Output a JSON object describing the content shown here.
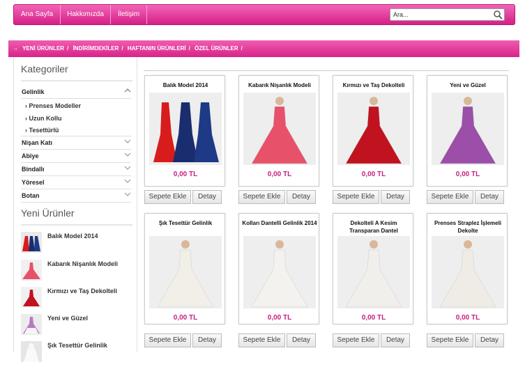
{
  "nav": {
    "home": "Ana Sayfa",
    "about": "Hakkımızda",
    "contact": "İletişim"
  },
  "search": {
    "placeholder": "Ara..."
  },
  "breadcrumb": {
    "arrow": "→",
    "items": [
      "YENİ ÜRÜNLER",
      "İNDİRİMDEKİLER",
      "HAFTANIN ÜRÜNLERİ",
      "ÖZEL ÜRÜNLER"
    ],
    "sep": "/"
  },
  "sidebar": {
    "categories_title": "Kategoriler",
    "categories": [
      {
        "label": "Gelinlik",
        "expanded": true
      },
      {
        "label": "Nişan Katı"
      },
      {
        "label": "Abiye"
      },
      {
        "label": "Bindallı"
      },
      {
        "label": "Yöresel"
      },
      {
        "label": "Botan"
      }
    ],
    "subcategories": [
      "Prenses Modeller",
      "Uzun Kollu",
      "Tesettürlü"
    ],
    "subcategory_bullet": "›",
    "new_products_title": "Yeni Ürünler",
    "new_products": [
      "Balık Model 2014",
      "Kabarık Nişanlık Modeli",
      "Kırmızı ve Taş Dekolteli",
      "Yeni ve Güzel",
      "Şık Tesettür Gelinlik"
    ]
  },
  "products": [
    {
      "title": "Balık Model 2014",
      "price": "0,00 TL",
      "colors": [
        "#d81c1c",
        "#1a2d6e",
        "#1e3a86"
      ]
    },
    {
      "title": "Kabarık Nişanlık Modeli",
      "price": "0,00 TL",
      "colors": [
        "#e8516a"
      ]
    },
    {
      "title": "Kırmızı ve Taş Dekolteli",
      "price": "0,00 TL",
      "colors": [
        "#c1121f"
      ]
    },
    {
      "title": "Yeni ve Güzel",
      "price": "0,00 TL",
      "colors": [
        "#9b4fa8"
      ]
    },
    {
      "title": "Şık Tesettür Gelinlik",
      "price": "0,00 TL",
      "colors": [
        "#f2efe9"
      ]
    },
    {
      "title": "Kolları Dantelli Gelinlik 2014",
      "price": "0,00 TL",
      "colors": [
        "#f4f2ee"
      ]
    },
    {
      "title": "Dekolteli A Kesim Transparan Dantel",
      "price": "0,00 TL",
      "colors": [
        "#f1efeb"
      ]
    },
    {
      "title": "Prenses Straplez İşlemeli Dekolte",
      "price": "0,00 TL",
      "colors": [
        "#efece6"
      ]
    }
  ],
  "buttons": {
    "add_to_cart": "Sepete Ekle",
    "details": "Detay"
  },
  "theme": {
    "accent": "#d61f86",
    "price": "#c61f81"
  }
}
